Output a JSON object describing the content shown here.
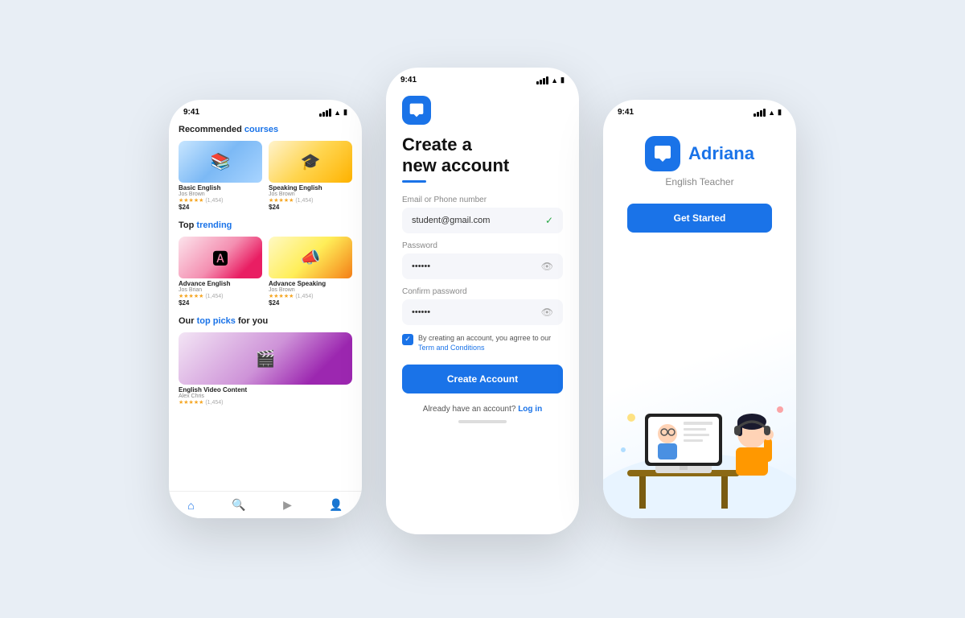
{
  "left_phone": {
    "time": "9:41",
    "sections": [
      {
        "title_prefix": "Recommended",
        "title_highlight": " courses",
        "courses": [
          {
            "name": "Basic English",
            "author": "Jos Brown",
            "rating": "★★★★★",
            "reviews": "(1,454)",
            "price": "$24",
            "thumb": "basic"
          },
          {
            "name": "Speaking English",
            "author": "Jos Brown",
            "rating": "★★★★★",
            "reviews": "(1,454)",
            "price": "$24",
            "thumb": "speaking"
          }
        ]
      },
      {
        "title_prefix": "Top",
        "title_highlight": " trending",
        "courses": [
          {
            "name": "Advance English",
            "author": "Jos Brian",
            "rating": "★★★★★",
            "reviews": "(1,454)",
            "price": "$24",
            "thumb": "advance"
          },
          {
            "name": "Advance Speaking",
            "author": "Jos Brown",
            "rating": "★★★★★",
            "reviews": "(1,454)",
            "price": "$24",
            "thumb": "adv-speaking"
          }
        ]
      },
      {
        "title_prefix": "Our",
        "title_highlight": " top picks",
        "title_suffix": " for you",
        "courses": [
          {
            "name": "English Video Content",
            "author": "Alex Chris",
            "rating": "★★★★★★",
            "reviews": "(1,454)",
            "price": "",
            "thumb": "video",
            "wide": true
          }
        ]
      }
    ],
    "nav": [
      "🏠",
      "🔍",
      "▶",
      "👤"
    ]
  },
  "center_phone": {
    "time": "9:41",
    "title_line1": "Create a",
    "title_line2": "new account",
    "email_label": "Email or Phone number",
    "email_value": "student@gmail.com",
    "password_label": "Password",
    "password_value": "••••••",
    "confirm_label": "Confirm password",
    "confirm_value": "••••••",
    "terms_text": "By creating an account, you agrree to our ",
    "terms_link": "Term and Conditions",
    "create_button": "Create Account",
    "login_text": "Already have an account?",
    "login_link": " Log in"
  },
  "right_phone": {
    "time": "9:41",
    "app_name": "Adriana",
    "subtitle": "English Teacher",
    "get_started": "Get Started"
  },
  "colors": {
    "primary": "#1a73e8",
    "text_dark": "#111111",
    "text_muted": "#888888",
    "star": "#f5a623",
    "success": "#28a745"
  }
}
